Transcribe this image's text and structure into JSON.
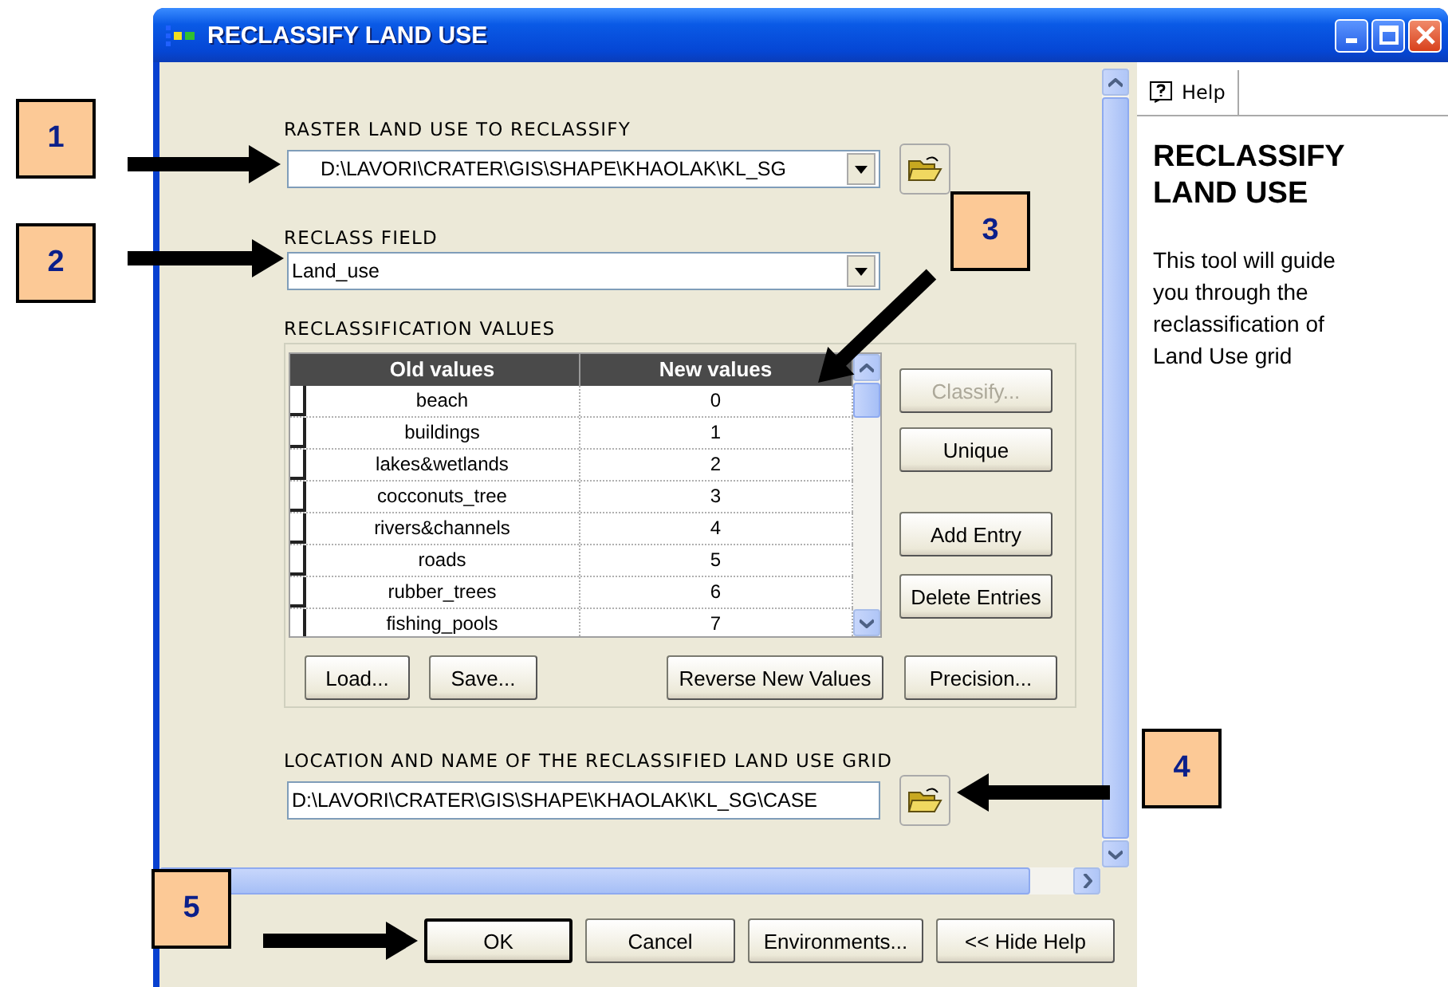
{
  "window": {
    "title": "RECLASSIFY LAND USE"
  },
  "raster_input": {
    "label": "RASTER LAND USE TO RECLASSIFY",
    "value": "D:\\LAVORI\\CRATER\\GIS\\SHAPE\\KHAOLAK\\KL_SG"
  },
  "reclass_field": {
    "label": "RECLASS FIELD",
    "value": "Land_use"
  },
  "reclassification": {
    "label": "RECLASSIFICATION VALUES",
    "columns": [
      "Old values",
      "New values"
    ],
    "rows": [
      {
        "old": "beach",
        "new": "0"
      },
      {
        "old": "buildings",
        "new": "1"
      },
      {
        "old": "lakes&wetlands",
        "new": "2"
      },
      {
        "old": "cocconuts_tree",
        "new": "3"
      },
      {
        "old": "rivers&channels",
        "new": "4"
      },
      {
        "old": "roads",
        "new": "5"
      },
      {
        "old": "rubber_trees",
        "new": "6"
      },
      {
        "old": "fishing_pools",
        "new": "7"
      }
    ],
    "side_buttons": [
      {
        "label": "Classify...",
        "disabled": true
      },
      {
        "label": "Unique",
        "disabled": false
      },
      {
        "label": "Add Entry",
        "disabled": false
      },
      {
        "label": "Delete Entries",
        "disabled": false
      }
    ],
    "bottom_buttons": [
      "Load...",
      "Save...",
      "Reverse New Values",
      "Precision..."
    ]
  },
  "output": {
    "label": "LOCATION AND NAME OF THE RECLASSIFIED LAND USE GRID",
    "value": "D:\\LAVORI\\CRATER\\GIS\\SHAPE\\KHAOLAK\\KL_SG\\CASE"
  },
  "buttons": [
    {
      "label": "OK",
      "default": true
    },
    {
      "label": "Cancel",
      "default": false
    },
    {
      "label": "Environments...",
      "default": false
    },
    {
      "label": "<< Hide Help",
      "default": false
    }
  ],
  "help": {
    "tab": "Help",
    "title": "RECLASSIFY LAND USE",
    "text": "This tool will guide you through the reclassification of Land Use grid"
  },
  "callouts": [
    "1",
    "2",
    "3",
    "4",
    "5"
  ]
}
